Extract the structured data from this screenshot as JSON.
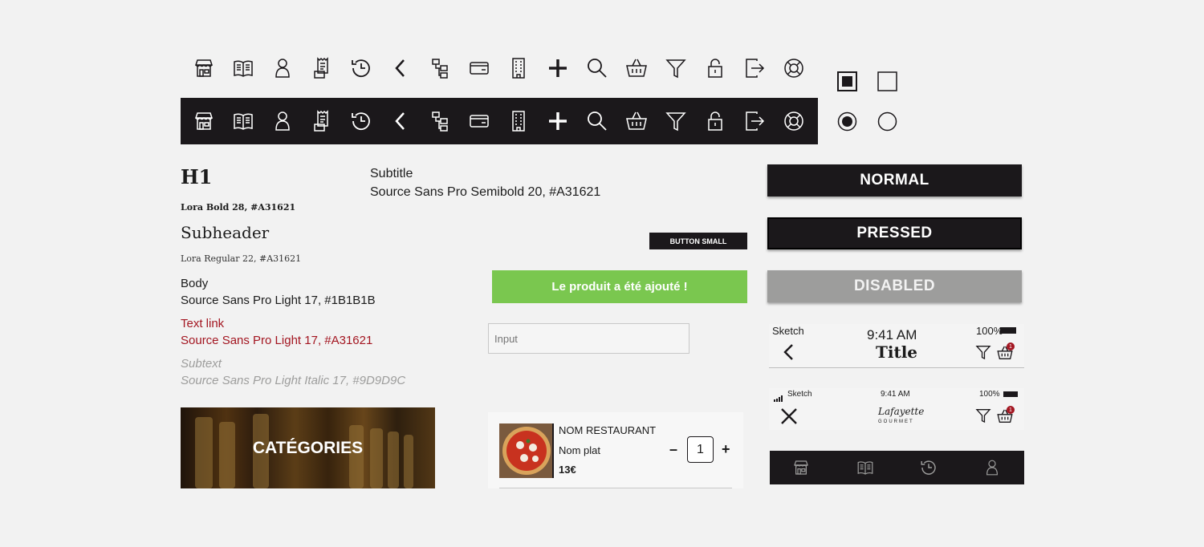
{
  "icons": [
    "store-icon",
    "menu-book-icon",
    "user-icon",
    "receipt-icon",
    "history-icon",
    "chevron-left-icon",
    "flowchart-icon",
    "credit-card-icon",
    "building-icon",
    "plus-icon",
    "search-icon",
    "basket-icon",
    "filter-icon",
    "lock-icon",
    "logout-icon",
    "lifebuoy-icon"
  ],
  "typography": {
    "h1": "H1",
    "h1_spec": "Lora Bold 28, #A31621",
    "subheader": "Subheader",
    "subheader_spec": "Lora Regular 22, #A31621",
    "body": "Body",
    "body_spec": "Source Sans Pro Light 17, #1B1B1B",
    "link": "Text link",
    "link_spec": "Source Sans Pro Light 17, #A31621",
    "subtext": "Subtext",
    "subtext_spec": "Source Sans Pro Light Italic 17, #9D9D9C",
    "subtitle": "Subtitle",
    "subtitle_spec": "Source Sans Pro Semibold 20, #A31621"
  },
  "buttons": {
    "small": "BUTTON SMALL",
    "normal": "NORMAL",
    "pressed": "PRESSED",
    "disabled": "DISABLED"
  },
  "toast": "Le produit a été ajouté !",
  "input": {
    "placeholder": "Input"
  },
  "category": {
    "label": "CATÉGORIES"
  },
  "cart_item": {
    "restaurant": "NOM RESTAURANT",
    "dish": "Nom plat",
    "price": "13€",
    "quantity": "1",
    "minus": "–",
    "plus": "+"
  },
  "header1": {
    "carrier": "Sketch",
    "time": "9:41 AM",
    "battery": "100%",
    "title": "Title",
    "badge": "1"
  },
  "header2": {
    "carrier": "Sketch",
    "time": "9:41 AM",
    "battery": "100%",
    "logo_text": "Lafayette",
    "logo_sub": "GOURMET",
    "badge": "1"
  },
  "colors": {
    "accent": "#A31621",
    "text": "#1B1B1B",
    "subtext": "#9D9D9C",
    "dark": "#1B181B",
    "success": "#7AC74F",
    "disabled": "#9D9D9C"
  }
}
